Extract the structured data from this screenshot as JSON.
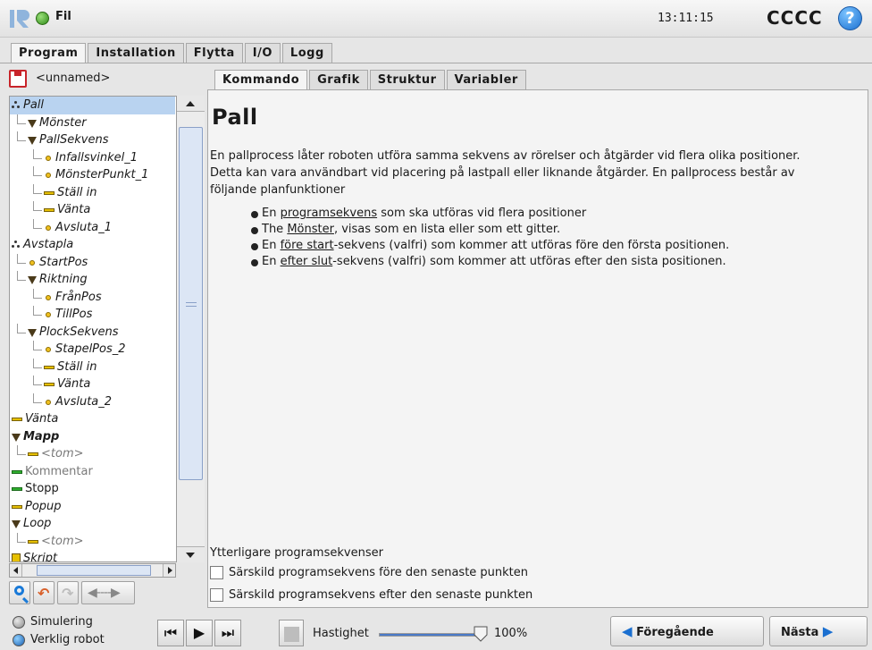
{
  "header": {
    "file_label": "Fil",
    "clock": "13:11:15",
    "robot_name": "CCCC",
    "help_glyph": "?"
  },
  "main_tabs": [
    "Program",
    "Installation",
    "Flytta",
    "I/O",
    "Logg"
  ],
  "active_main_tab": "Program",
  "program_name": "<unnamed>",
  "tree": [
    {
      "label": "Pall",
      "icon": "pallet-icon",
      "style": "it",
      "selected": true
    },
    {
      "label": "Mönster",
      "icon": "triangle-icon",
      "style": "it"
    },
    {
      "label": "PallSekvens",
      "icon": "triangle-icon",
      "style": "it"
    },
    {
      "label": "Infallsvinkel_1",
      "icon": "waypoint-icon",
      "style": "it"
    },
    {
      "label": "MönsterPunkt_1",
      "icon": "waypoint-icon",
      "style": "it"
    },
    {
      "label": "Ställ in",
      "icon": "set-icon",
      "style": "it"
    },
    {
      "label": "Vänta",
      "icon": "wait-icon",
      "style": "it"
    },
    {
      "label": "Avsluta_1",
      "icon": "waypoint-icon",
      "style": "it"
    },
    {
      "label": "Avstapla",
      "icon": "pallet-icon",
      "style": "it"
    },
    {
      "label": "StartPos",
      "icon": "waypoint-icon",
      "style": "it"
    },
    {
      "label": "Riktning",
      "icon": "triangle-icon",
      "style": "it"
    },
    {
      "label": "FrånPos",
      "icon": "waypoint-icon",
      "style": "it"
    },
    {
      "label": "TillPos",
      "icon": "waypoint-icon",
      "style": "it"
    },
    {
      "label": "PlockSekvens",
      "icon": "triangle-icon",
      "style": "it"
    },
    {
      "label": "StapelPos_2",
      "icon": "waypoint-icon",
      "style": "it"
    },
    {
      "label": "Ställ in",
      "icon": "set-icon",
      "style": "it"
    },
    {
      "label": "Vänta",
      "icon": "wait-icon",
      "style": "it"
    },
    {
      "label": "Avsluta_2",
      "icon": "waypoint-icon",
      "style": "it"
    },
    {
      "label": "Vänta",
      "icon": "wait-icon",
      "style": "it"
    },
    {
      "label": "Mapp",
      "icon": "triangle-icon",
      "style": "it bold"
    },
    {
      "label": "<tom>",
      "icon": "wait-icon",
      "style": "it muted"
    },
    {
      "label": "Kommentar",
      "icon": "comment-icon",
      "style": "muted"
    },
    {
      "label": "Stopp",
      "icon": "stop-icon",
      "style": ""
    },
    {
      "label": "Popup",
      "icon": "wait-icon",
      "style": "it"
    },
    {
      "label": "Loop",
      "icon": "triangle-icon",
      "style": "it"
    },
    {
      "label": "<tom>",
      "icon": "wait-icon",
      "style": "it muted"
    },
    {
      "label": "Skript",
      "icon": "script-icon",
      "style": "it"
    }
  ],
  "sub_tabs": [
    "Kommando",
    "Grafik",
    "Struktur",
    "Variabler"
  ],
  "active_sub_tab": "Kommando",
  "content": {
    "title": "Pall",
    "intro": "En pallprocess låter roboten utföra samma sekvens av rörelser och åtgärder vid flera olika positioner. Detta kan vara användbart vid placering på lastpall eller liknande åtgärder. En pallprocess består av följande planfunktioner",
    "bullets": [
      {
        "pre": "En ",
        "link": "programsekvens",
        "post": " som ska utföras vid flera positioner"
      },
      {
        "pre": "The ",
        "link": "Mönster",
        "post": ", visas som en lista eller som ett gitter."
      },
      {
        "pre": "En ",
        "link": "före start",
        "post": "-sekvens (valfri) som kommer att utföras före den första positionen."
      },
      {
        "pre": "En ",
        "link": "efter slut",
        "post": "-sekvens (valfri) som kommer att utföras efter den sista positionen."
      }
    ],
    "extra_label": "Ytterligare programsekvenser",
    "checkbox_before": "Särskild programsekvens före den senaste punkten",
    "checkbox_after": "Särskild programsekvens efter den senaste punkten"
  },
  "bottom": {
    "mode_sim": "Simulering",
    "mode_real": "Verklig robot",
    "speed_label": "Hastighet",
    "speed_value": "100%",
    "speed_fraction": 1.0,
    "prev_label": "Föregående",
    "next_label": "Nästa"
  },
  "colors": {
    "accent": "#1a6fd0",
    "status_green": "#2e8a17",
    "selection": "#b9d3f0"
  }
}
